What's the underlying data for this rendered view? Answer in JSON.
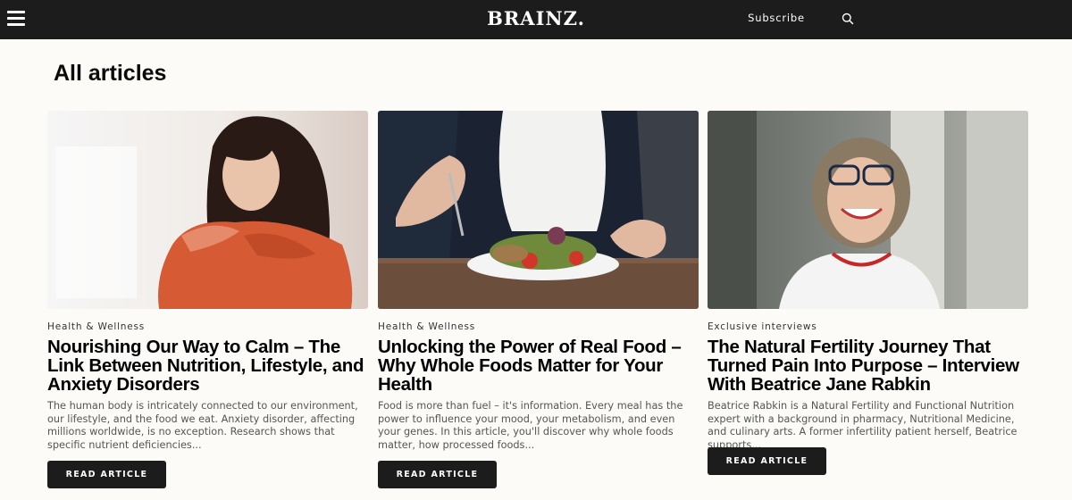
{
  "header": {
    "logo": "BRAINZ.",
    "subscribe_label": "Subscribe",
    "background": "#1c1c1c"
  },
  "page_title": "All articles",
  "articles": [
    {
      "category": "Health & Wellness",
      "title": "Nourishing Our Way to Calm – The Link Between Nutrition, Lifestyle, and Anxiety Disorders",
      "excerpt": "The human body is intricately connected to our environment, our lifestyle, and the food we eat. Anxiety disorder, affecting millions worldwide, is no exception. Research shows that specific nutrient deficiencies...",
      "button_label": "READ ARTICLE",
      "image": "woman-in-orange-sweater-hugging-herself"
    },
    {
      "category": "Health & Wellness",
      "title": "Unlocking the Power of Real Food – Why Whole Foods Matter for Your Health",
      "excerpt": "Food is more than fuel – it's information. Every meal has the power to influence your mood, your metabolism, and even your genes. In this article, you'll discover why whole foods matter, how processed foods...",
      "button_label": "READ ARTICLE",
      "image": "person-eating-salad-plate"
    },
    {
      "category": "Exclusive interviews",
      "title": "The Natural Fertility Journey That Turned Pain Into Purpose – Interview With Beatrice Jane Rabkin",
      "excerpt": "Beatrice Rabkin is a Natural Fertility and Functional Nutrition expert with a background in pharmacy, Nutritional Medicine, and culinary arts. A former infertility patient herself, Beatrice supports...",
      "button_label": "READ ARTICLE",
      "image": "smiling-woman-with-glasses-portrait"
    }
  ],
  "icons": {
    "menu": "hamburger-menu-icon",
    "search": "search-icon"
  }
}
